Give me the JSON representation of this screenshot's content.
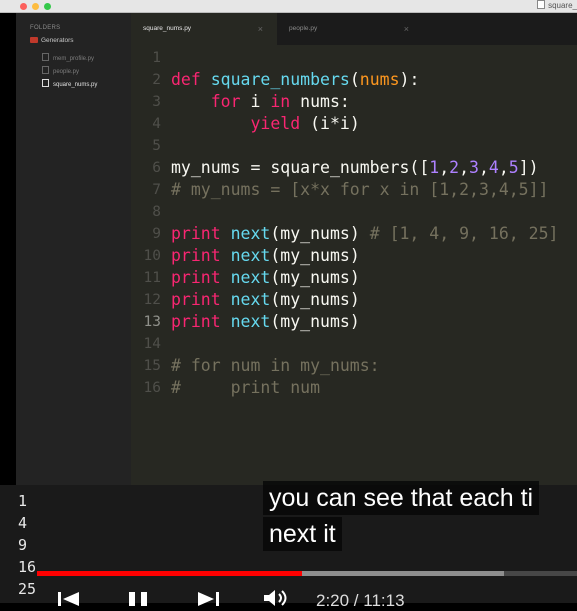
{
  "window": {
    "title": "square_"
  },
  "sidebar": {
    "heading": "FOLDERS",
    "folder": "Generators",
    "files": [
      {
        "name": "mem_profile.py",
        "active": false
      },
      {
        "name": "people.py",
        "active": false
      },
      {
        "name": "square_nums.py",
        "active": true
      }
    ]
  },
  "tabs": [
    {
      "label": "square_nums.py",
      "close": "×"
    },
    {
      "label": "people.py",
      "close": "×"
    }
  ],
  "editor": {
    "line_numbers": [
      "1",
      "2",
      "3",
      "4",
      "5",
      "6",
      "7",
      "8",
      "9",
      "10",
      "11",
      "12",
      "13",
      "14",
      "15",
      "16"
    ],
    "lines": [
      "",
      "def square_numbers(nums):",
      "    for i in nums:",
      "        yield (i*i)",
      "",
      "my_nums = square_numbers([1,2,3,4,5])",
      "# my_nums = [x*x for x in [1,2,3,4,5]]",
      "",
      "print next(my_nums) # [1, 4, 9, 16, 25]",
      "print next(my_nums)",
      "print next(my_nums)",
      "print next(my_nums)",
      "print next(my_nums)",
      "",
      "# for num in my_nums:",
      "#     print num"
    ],
    "cursor_line": "13"
  },
  "console": {
    "output": [
      "1",
      "4",
      "9",
      "16",
      "25"
    ]
  },
  "captions": {
    "line1": "you can see that each ti",
    "line2": "next it"
  },
  "player": {
    "time": "2:20 / 11:13",
    "played_fraction": 0.49,
    "buffered_fraction": 0.865,
    "accent": "#ff0000"
  }
}
